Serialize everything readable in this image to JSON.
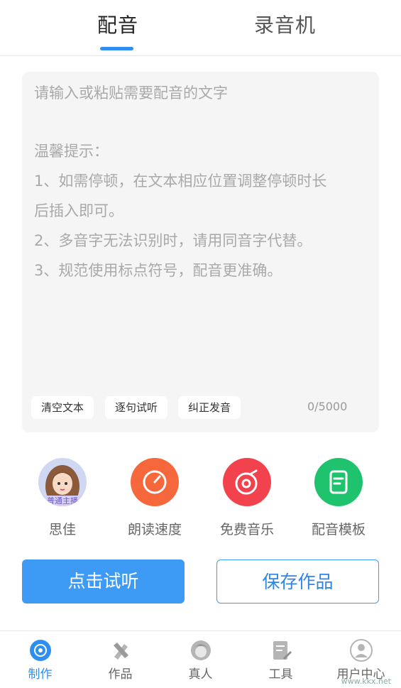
{
  "tabs": {
    "dub": "配音",
    "recorder": "录音机"
  },
  "editor": {
    "placeholder": "请输入或粘贴需要配音的文字",
    "tips": [
      "温馨提示：",
      "1、如需停顿，在文本相应位置调整停顿时长",
      "后插入即可。",
      "2、多音字无法识别时，请用同音字代替。",
      "3、规范使用标点符号，配音更准确。"
    ],
    "chips": {
      "clear": "清空文本",
      "sentence": "逐句试听",
      "correct": "纠正发音"
    },
    "counter": "0/5000"
  },
  "tools": {
    "anchor": {
      "label": "思佳",
      "badge": "普通主播"
    },
    "speed": {
      "label": "朗读速度",
      "icon": "speedometer-icon",
      "color": "#f6673b"
    },
    "music": {
      "label": "免费音乐",
      "icon": "music-disc-icon",
      "color": "#f2424e"
    },
    "template": {
      "label": "配音模板",
      "icon": "document-icon",
      "color": "#1fc26d"
    }
  },
  "actions": {
    "listen": "点击试听",
    "save": "保存作品"
  },
  "nav": {
    "make": "制作",
    "works": "作品",
    "human": "真人",
    "tools": "工具",
    "user": "用户中心"
  },
  "watermark": "www.kkx.net",
  "colors": {
    "accent": "#2f8ff0",
    "button": "#3d9bf5"
  }
}
